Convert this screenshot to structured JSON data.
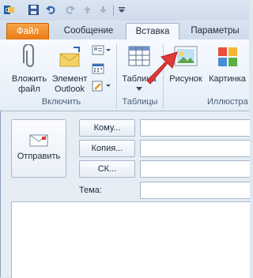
{
  "colors": {
    "file_tab": "#e9770f",
    "arrow": "#e0393a",
    "ribbon_bg": "#eef3fa"
  },
  "quick_access": {
    "icons": [
      "outlook-logo-icon",
      "save-icon",
      "undo-icon",
      "redo-icon",
      "up-arrow-icon",
      "down-arrow-icon",
      "customize-dropdown-icon"
    ]
  },
  "tabs": {
    "file": "Файл",
    "message": "Сообщение",
    "insert": "Вставка",
    "options": "Параметры"
  },
  "ribbon": {
    "attach_file": [
      "Вложить",
      "файл"
    ],
    "outlook_item": [
      "Элемент",
      "Outlook"
    ],
    "table": "Таблица",
    "picture": "Рисунок",
    "clipart": "Картинка",
    "group_include": "Включить",
    "group_tables": "Таблицы",
    "group_illustrations": "Иллюстра"
  },
  "compose": {
    "send": "Отправить",
    "to": "Кому...",
    "cc": "Копия...",
    "bcc": "СК...",
    "subject": "Тема:"
  }
}
